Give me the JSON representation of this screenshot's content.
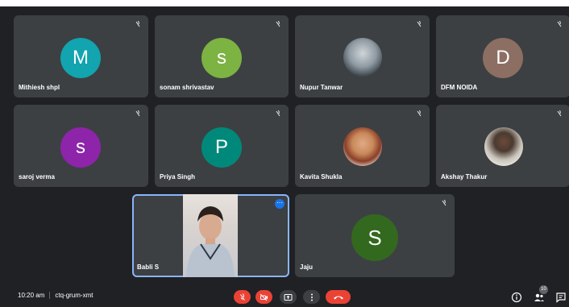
{
  "participants": [
    {
      "name": "Mithiesh shpl",
      "initial": "M",
      "color": "#12a4af"
    },
    {
      "name": "sonam shrivastav",
      "initial": "s",
      "color": "#7cb342"
    },
    {
      "name": "Nupur Tanwar",
      "initial": "",
      "color": "#5c6670"
    },
    {
      "name": "DFM NOIDA",
      "initial": "D",
      "color": "#8d6e63"
    },
    {
      "name": "saroj verma",
      "initial": "s",
      "color": "#8e24aa"
    },
    {
      "name": "Priya Singh",
      "initial": "P",
      "color": "#00897b"
    },
    {
      "name": "Kavita Shukla",
      "initial": "",
      "color": "#c98a5b"
    },
    {
      "name": "Akshay Thakur",
      "initial": "",
      "color": "#8f8b86"
    },
    {
      "name": "Babli S",
      "initial": "",
      "color": "#d8cfca"
    },
    {
      "name": "Jaju",
      "initial": "S",
      "color": "#33691e"
    }
  ],
  "bottombar": {
    "time": "10:20 am",
    "meeting_code": "ctq-grum-xmt",
    "people_count": "10"
  },
  "colors": {
    "background": "#202124",
    "tile": "#3c4043",
    "end_call": "#ea4335",
    "active_border": "#8ab4f8"
  }
}
